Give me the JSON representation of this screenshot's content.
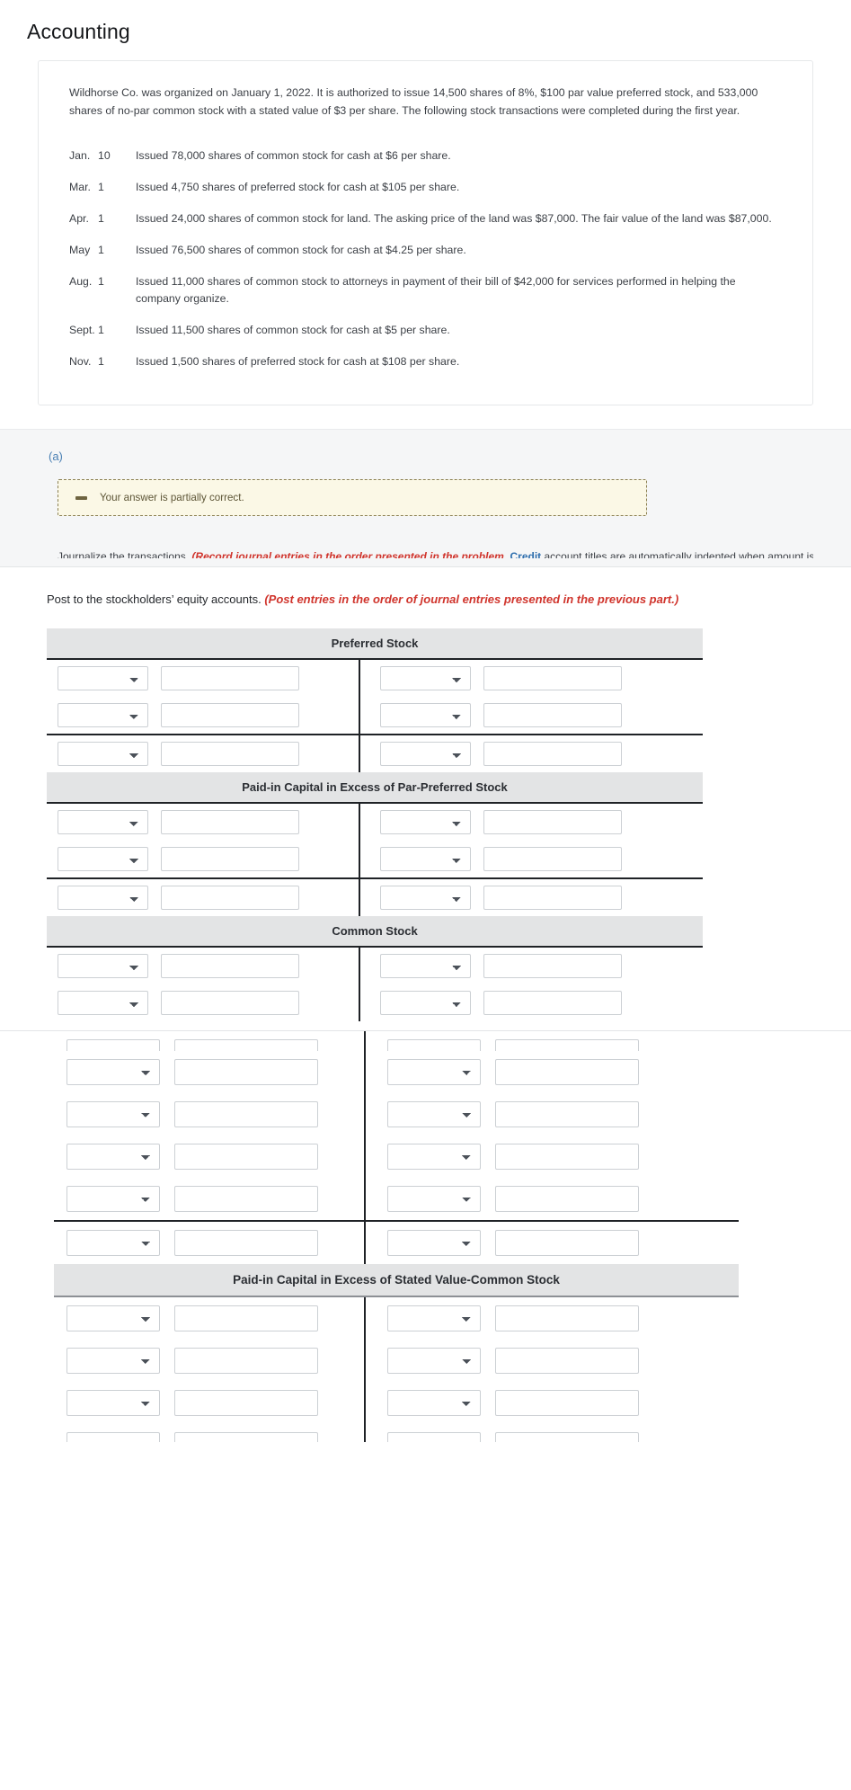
{
  "header": {
    "title": "Accounting"
  },
  "problem": {
    "intro": "Wildhorse Co. was organized on January 1, 2022. It is authorized to issue 14,500 shares of 8%, $100 par value preferred stock, and 533,000 shares of no-par common stock with a stated value of $3 per share. The following stock transactions were completed during the first year.",
    "transactions": [
      {
        "month": "Jan.",
        "day": "10",
        "description": "Issued 78,000 shares of common stock for cash at $6 per share."
      },
      {
        "month": "Mar.",
        "day": "1",
        "description": "Issued 4,750 shares of preferred stock for cash at $105 per share."
      },
      {
        "month": "Apr.",
        "day": "1",
        "description": "Issued 24,000 shares of common stock for land. The asking price of the land was $87,000. The fair value of the land was $87,000."
      },
      {
        "month": "May",
        "day": "1",
        "description": "Issued 76,500 shares of common stock for cash at $4.25 per share."
      },
      {
        "month": "Aug.",
        "day": "1",
        "description": "Issued 11,000 shares of common stock to attorneys in payment of their bill of $42,000 for services performed in helping the company organize."
      },
      {
        "month": "Sept.",
        "day": "1",
        "description": "Issued 11,500 shares of common stock for cash at $5 per share."
      },
      {
        "month": "Nov.",
        "day": "1",
        "description": "Issued 1,500 shares of preferred stock for cash at $108 per share."
      }
    ]
  },
  "part_a": {
    "label": "(a)",
    "alert": {
      "text": "Your answer is partially correct.",
      "icon": "minus-icon"
    },
    "clipped_line": {
      "before": "Journalize the transactions. ",
      "red": "(Record journal entries in the order presented in the problem. ",
      "blue": "Credit",
      "after": " account titles are automatically indented when amount is entered. Do not indent manually.)"
    }
  },
  "ledger": {
    "instruction_plain": "Post to the stockholders’ equity accounts. ",
    "instruction_emph": "(Post entries in the order of journal entries presented in the previous part.)",
    "select_placeholder": "",
    "input_placeholder": "",
    "accounts": [
      {
        "title": "Preferred Stock",
        "rows": [
          {
            "left_select": "",
            "left_value": "",
            "right_select": "",
            "right_value": ""
          },
          {
            "left_select": "",
            "left_value": "",
            "right_select": "",
            "right_value": ""
          }
        ],
        "total_row": {
          "left_select": "",
          "left_value": "",
          "right_select": "",
          "right_value": ""
        }
      },
      {
        "title": "Paid-in Capital in Excess of Par-Preferred Stock",
        "rows": [
          {
            "left_select": "",
            "left_value": "",
            "right_select": "",
            "right_value": ""
          },
          {
            "left_select": "",
            "left_value": "",
            "right_select": "",
            "right_value": ""
          }
        ],
        "total_row": {
          "left_select": "",
          "left_value": "",
          "right_select": "",
          "right_value": ""
        }
      },
      {
        "title": "Common Stock",
        "rows": [
          {
            "left_select": "",
            "left_value": "",
            "right_select": "",
            "right_value": ""
          },
          {
            "left_select": "",
            "left_value": "",
            "right_select": "",
            "right_value": ""
          }
        ],
        "total_row": null
      }
    ]
  },
  "ledger_lower": {
    "clipped_first_row": {
      "left_select": "",
      "left_value": "",
      "right_select": "",
      "right_value": ""
    },
    "common_stock_rows": [
      {
        "left_select": "",
        "left_value": "",
        "right_select": "",
        "right_value": ""
      },
      {
        "left_select": "",
        "left_value": "",
        "right_select": "",
        "right_value": ""
      },
      {
        "left_select": "",
        "left_value": "",
        "right_select": "",
        "right_value": ""
      },
      {
        "left_select": "",
        "left_value": "",
        "right_select": "",
        "right_value": ""
      }
    ],
    "common_stock_total": {
      "left_select": "",
      "left_value": "",
      "right_select": "",
      "right_value": ""
    },
    "account": {
      "title": "Paid-in Capital in Excess of Stated Value-Common Stock",
      "rows": [
        {
          "left_select": "",
          "left_value": "",
          "right_select": "",
          "right_value": ""
        },
        {
          "left_select": "",
          "left_value": "",
          "right_select": "",
          "right_value": ""
        },
        {
          "left_select": "",
          "left_value": "",
          "right_select": "",
          "right_value": ""
        }
      ],
      "clipped_last_row": {
        "left_select": "",
        "left_value": "",
        "right_select": "",
        "right_value": ""
      }
    }
  },
  "colors": {
    "accent_blue": "#4a80b4",
    "alert_red": "#d0342c",
    "alert_bg": "#fbf8e6",
    "alert_border": "#8a7f52",
    "header_gray": "#e3e4e5",
    "rule_dark": "#1f2226"
  }
}
